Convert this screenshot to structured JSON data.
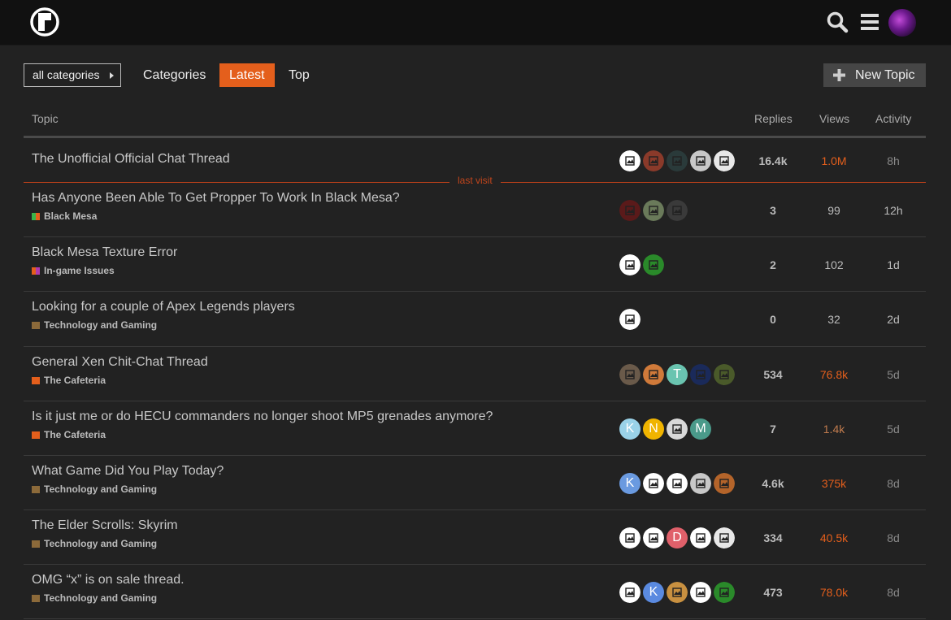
{
  "header": {
    "logo": "lambda-logo",
    "icons": [
      "search-icon",
      "hamburger-menu-icon"
    ]
  },
  "nav": {
    "category_dropdown": "all categories",
    "tabs": [
      {
        "label": "Categories",
        "active": false
      },
      {
        "label": "Latest",
        "active": true
      },
      {
        "label": "Top",
        "active": false
      }
    ],
    "new_topic": "New Topic"
  },
  "columns": {
    "topic": "Topic",
    "replies": "Replies",
    "views": "Views",
    "activity": "Activity"
  },
  "last_visit_label": "last visit",
  "colors": {
    "accent": "#e45f1c",
    "header_bg": "#111111",
    "page_bg": "#222222"
  },
  "topics": [
    {
      "title": "The Unofficial Official Chat Thread",
      "category": "",
      "cat_colors": [],
      "replies": "16.4k",
      "views": "1.0M",
      "activity": "8h",
      "posters": [
        {
          "t": "img",
          "bg": "#ffffff"
        },
        {
          "t": "img",
          "bg": "#8a3a2a"
        },
        {
          "t": "img",
          "bg": "#2a3a3a"
        },
        {
          "t": "img",
          "bg": "#c8c8c8"
        },
        {
          "t": "img",
          "bg": "#e8e8e8"
        }
      ]
    },
    {
      "title": "Has Anyone Been Able To Get Propper To Work In Black Mesa?",
      "category": "Black Mesa",
      "cat_colors": [
        "#3ab54a",
        "#e45f1c"
      ],
      "replies": "3",
      "views": "99",
      "activity": "12h",
      "posters": [
        {
          "t": "img",
          "bg": "#5a1a1a"
        },
        {
          "t": "img",
          "bg": "#6a7a5a"
        },
        {
          "t": "img",
          "bg": "#3a3a3a"
        }
      ]
    },
    {
      "title": "Black Mesa Texture Error",
      "category": "In-game Issues",
      "cat_colors": [
        "#e45f1c",
        "#b03ab0"
      ],
      "replies": "2",
      "views": "102",
      "activity": "1d",
      "posters": [
        {
          "t": "img",
          "bg": "#ffffff"
        },
        {
          "t": "img",
          "bg": "#2a8a2a"
        }
      ]
    },
    {
      "title": "Looking for a couple of Apex Legends players",
      "category": "Technology and Gaming",
      "cat_colors": [
        "#8c6a3a"
      ],
      "replies": "0",
      "views": "32",
      "activity": "2d",
      "posters": [
        {
          "t": "img",
          "bg": "#ffffff"
        }
      ]
    },
    {
      "title": "General Xen Chit-Chat Thread",
      "category": "The Cafeteria",
      "cat_colors": [
        "#e45f1c"
      ],
      "replies": "534",
      "views": "76.8k",
      "activity": "5d",
      "posters": [
        {
          "t": "img",
          "bg": "#6a5a4a"
        },
        {
          "t": "img",
          "bg": "#d07a3a"
        },
        {
          "t": "letter",
          "letter": "T",
          "bg": "#6ac4b0"
        },
        {
          "t": "img",
          "bg": "#1a2a5a"
        },
        {
          "t": "img",
          "bg": "#4a5a2a"
        }
      ]
    },
    {
      "title": "Is it just me or do HECU commanders no longer shoot MP5 grenades anymore?",
      "category": "The Cafeteria",
      "cat_colors": [
        "#e45f1c"
      ],
      "replies": "7",
      "views": "1.4k",
      "activity": "5d",
      "posters": [
        {
          "t": "letter",
          "letter": "K",
          "bg": "#9ad2e8"
        },
        {
          "t": "letter",
          "letter": "N",
          "bg": "#f0b400"
        },
        {
          "t": "img",
          "bg": "#d8d8d8"
        },
        {
          "t": "letter",
          "letter": "M",
          "bg": "#4a9a8a"
        }
      ]
    },
    {
      "title": "What Game Did You Play Today?",
      "category": "Technology and Gaming",
      "cat_colors": [
        "#8c6a3a"
      ],
      "replies": "4.6k",
      "views": "375k",
      "activity": "8d",
      "posters": [
        {
          "t": "letter",
          "letter": "K",
          "bg": "#6a9ae0"
        },
        {
          "t": "img",
          "bg": "#ffffff"
        },
        {
          "t": "img",
          "bg": "#ffffff"
        },
        {
          "t": "img",
          "bg": "#c8c8c8"
        },
        {
          "t": "img",
          "bg": "#b4642a"
        }
      ]
    },
    {
      "title": "The Elder Scrolls: Skyrim",
      "category": "Technology and Gaming",
      "cat_colors": [
        "#8c6a3a"
      ],
      "replies": "334",
      "views": "40.5k",
      "activity": "8d",
      "posters": [
        {
          "t": "img",
          "bg": "#ffffff"
        },
        {
          "t": "img",
          "bg": "#ffffff"
        },
        {
          "t": "letter",
          "letter": "D",
          "bg": "#e0606a"
        },
        {
          "t": "img",
          "bg": "#ffffff"
        },
        {
          "t": "img",
          "bg": "#e8e8e8"
        }
      ]
    },
    {
      "title": "OMG “x” is on sale thread.",
      "category": "Technology and Gaming",
      "cat_colors": [
        "#8c6a3a"
      ],
      "replies": "473",
      "views": "78.0k",
      "activity": "8d",
      "posters": [
        {
          "t": "img",
          "bg": "#ffffff"
        },
        {
          "t": "letter",
          "letter": "K",
          "bg": "#5a8ae0"
        },
        {
          "t": "img",
          "bg": "#c89040"
        },
        {
          "t": "img",
          "bg": "#ffffff"
        },
        {
          "t": "img",
          "bg": "#2a8a2a"
        }
      ]
    }
  ]
}
